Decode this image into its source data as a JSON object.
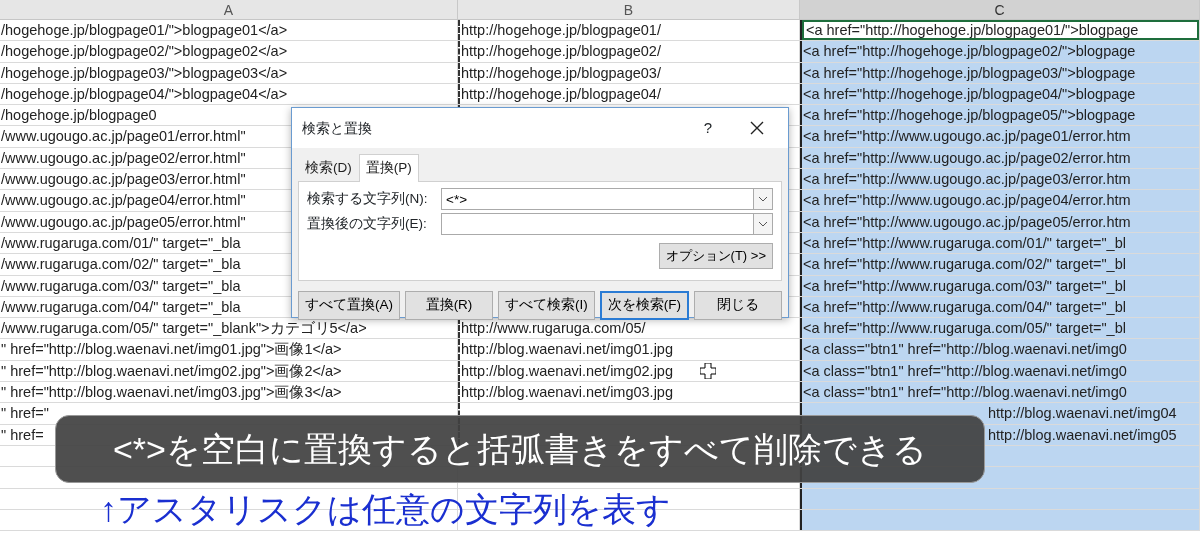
{
  "sheet": {
    "columns": [
      {
        "label": "A",
        "selected": false
      },
      {
        "label": "B",
        "selected": false
      },
      {
        "label": "C",
        "selected": true
      }
    ],
    "rows": [
      {
        "active": true,
        "cells": [
          "/hogehoge.jp/blogpage01/\">blogpage01</a>",
          "http://hogehoge.jp/blogpage01/",
          "<a href=\"http://hogehoge.jp/blogpage01/\">blogpage"
        ]
      },
      {
        "active": false,
        "cells": [
          "/hogehoge.jp/blogpage02/\">blogpage02</a>",
          "http://hogehoge.jp/blogpage02/",
          "<a href=\"http://hogehoge.jp/blogpage02/\">blogpage"
        ]
      },
      {
        "active": false,
        "cells": [
          "/hogehoge.jp/blogpage03/\">blogpage03</a>",
          "http://hogehoge.jp/blogpage03/",
          "<a href=\"http://hogehoge.jp/blogpage03/\">blogpage"
        ]
      },
      {
        "active": false,
        "cells": [
          "/hogehoge.jp/blogpage04/\">blogpage04</a>",
          "http://hogehoge.jp/blogpage04/",
          "<a href=\"http://hogehoge.jp/blogpage04/\">blogpage"
        ]
      },
      {
        "active": false,
        "cells": [
          "/hogehoge.jp/blogpage0",
          "",
          "<a href=\"http://hogehoge.jp/blogpage05/\">blogpage"
        ]
      },
      {
        "active": false,
        "cells": [
          "/www.ugougo.ac.jp/page01/error.html\"",
          "",
          "<a href=\"http://www.ugougo.ac.jp/page01/error.htm"
        ]
      },
      {
        "active": false,
        "cells": [
          "/www.ugougo.ac.jp/page02/error.html\"",
          "",
          "<a href=\"http://www.ugougo.ac.jp/page02/error.htm"
        ]
      },
      {
        "active": false,
        "cells": [
          "/www.ugougo.ac.jp/page03/error.html\"",
          "",
          "<a href=\"http://www.ugougo.ac.jp/page03/error.htm"
        ]
      },
      {
        "active": false,
        "cells": [
          "/www.ugougo.ac.jp/page04/error.html\"",
          "",
          "<a href=\"http://www.ugougo.ac.jp/page04/error.htm"
        ]
      },
      {
        "active": false,
        "cells": [
          "/www.ugougo.ac.jp/page05/error.html\"",
          "",
          "<a href=\"http://www.ugougo.ac.jp/page05/error.htm"
        ]
      },
      {
        "active": false,
        "cells": [
          "/www.rugaruga.com/01/\" target=\"_bla",
          "",
          "<a href=\"http://www.rugaruga.com/01/\" target=\"_bl"
        ]
      },
      {
        "active": false,
        "cells": [
          "/www.rugaruga.com/02/\" target=\"_bla",
          "",
          "<a href=\"http://www.rugaruga.com/02/\" target=\"_bl"
        ]
      },
      {
        "active": false,
        "cells": [
          "/www.rugaruga.com/03/\" target=\"_bla",
          "",
          "<a href=\"http://www.rugaruga.com/03/\" target=\"_bl"
        ]
      },
      {
        "active": false,
        "cells": [
          "/www.rugaruga.com/04/\" target=\"_bla",
          "",
          "<a href=\"http://www.rugaruga.com/04/\" target=\"_bl"
        ]
      },
      {
        "active": false,
        "cells": [
          "/www.rugaruga.com/05/\" target=\"_blank\">カテゴリ5</a>",
          "http://www.rugaruga.com/05/",
          "<a href=\"http://www.rugaruga.com/05/\" target=\"_bl"
        ]
      },
      {
        "active": false,
        "cells": [
          "\" href=\"http://blog.waenavi.net/img01.jpg\">画像1</a>",
          "http://blog.waenavi.net/img01.jpg",
          "<a class=\"btn1\" href=\"http://blog.waenavi.net/img0"
        ]
      },
      {
        "active": false,
        "cells": [
          "\" href=\"http://blog.waenavi.net/img02.jpg\">画像2</a>",
          "http://blog.waenavi.net/img02.jpg",
          "<a class=\"btn1\" href=\"http://blog.waenavi.net/img0"
        ]
      },
      {
        "active": false,
        "cells": [
          "\" href=\"http://blog.waenavi.net/img03.jpg\">画像3</a>",
          "http://blog.waenavi.net/img03.jpg",
          "<a class=\"btn1\" href=\"http://blog.waenavi.net/img0"
        ]
      },
      {
        "active": false,
        "cells": [
          "\" href=\"",
          "",
          "http://blog.waenavi.net/img04"
        ]
      },
      {
        "active": false,
        "cells": [
          "\" href=",
          "",
          "http://blog.waenavi.net/img05"
        ]
      }
    ]
  },
  "dialog": {
    "title": "検索と置換",
    "help": "?",
    "tabs": [
      {
        "label": "検索(D)",
        "selected": false
      },
      {
        "label": "置換(P)",
        "selected": true
      }
    ],
    "fields": [
      {
        "label": "検索する文字列(N):",
        "value": "<*>"
      },
      {
        "label": "置換後の文字列(E):"
      }
    ],
    "options_button": "オプション(T) >>",
    "buttons": [
      {
        "label": "すべて置換(A)",
        "default": false
      },
      {
        "label": "置換(R)",
        "default": false
      },
      {
        "label": "すべて検索(I)",
        "default": false
      },
      {
        "label": "次を検索(F)",
        "default": true
      },
      {
        "label": "閉じる",
        "default": false
      }
    ]
  },
  "caption": "<*>を空白に置換すると括弧書きをすべて削除できる",
  "note": "↑アスタリスクは任意の文字列を表す"
}
